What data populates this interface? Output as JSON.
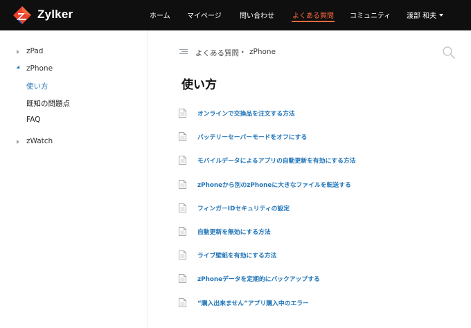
{
  "header": {
    "brand": "Zylker",
    "nav": [
      {
        "label": "ホーム",
        "active": false
      },
      {
        "label": "マイページ",
        "active": false
      },
      {
        "label": "問い合わせ",
        "active": false
      },
      {
        "label": "よくある質問",
        "active": true
      },
      {
        "label": "コミュニティ",
        "active": false
      }
    ],
    "user": "渡部 和夫"
  },
  "sidebar": {
    "categories": [
      {
        "label": "zPad",
        "expanded": false
      },
      {
        "label": "zPhone",
        "expanded": true
      },
      {
        "label": "zWatch",
        "expanded": false
      }
    ],
    "subitems": [
      {
        "label": "使い方",
        "active": true
      },
      {
        "label": "既知の問題点",
        "active": false
      },
      {
        "label": "FAQ",
        "active": false
      }
    ]
  },
  "breadcrumb": {
    "root": "よくある質問",
    "current": "zPhone"
  },
  "main": {
    "title": "使い方",
    "articles": [
      "オンラインで交換品を注文する方法",
      "バッテリーセーバーモードをオフにする",
      "モバイルデータによるアプリの自動更新を有効にする方法",
      "zPhoneから別のzPhoneに大きなファイルを転送する",
      "フィンガーIDセキュリティの設定",
      "自動更新を無効にする方法",
      "ライブ壁紙を有効にする方法",
      "zPhoneデータを定期的にバックアップする",
      "“購入出来ません”アプリ購入中のエラー"
    ]
  },
  "colors": {
    "header_bg": "#0f0f10",
    "accent": "#ff6a3c",
    "link": "#1f73b7"
  },
  "icons": {
    "logo": "zylker-logo-icon",
    "search": "search-icon",
    "breadcrumb": "list-icon",
    "article": "document-icon"
  }
}
